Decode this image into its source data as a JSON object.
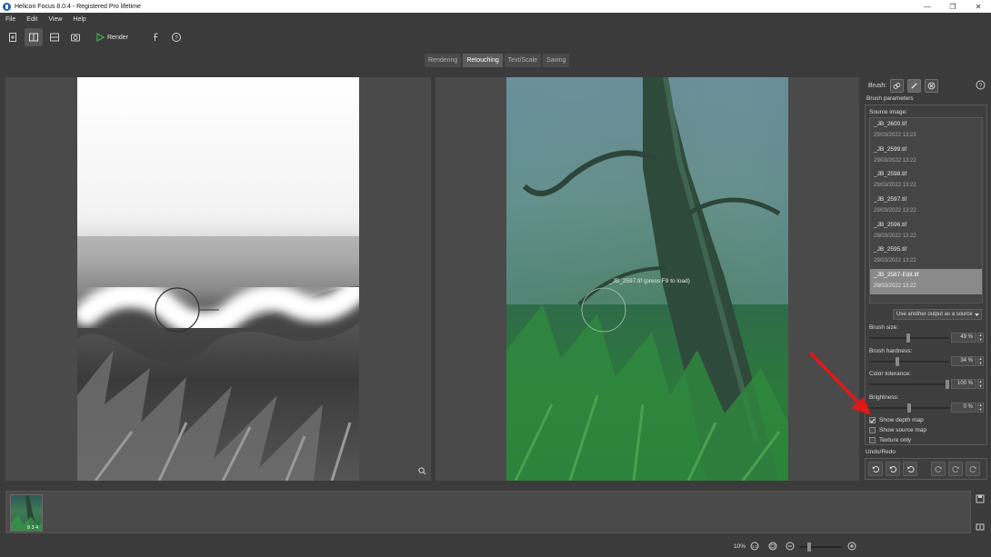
{
  "window": {
    "title": "Helicon Focus 8.0.4 - Registered Pro lifetime",
    "controls": [
      "—",
      "❐",
      "✕"
    ]
  },
  "menu": [
    "File",
    "Edit",
    "View",
    "Help"
  ],
  "toolbar": {
    "render_label": "Render"
  },
  "tabs": [
    "Rendering",
    "Retouching",
    "Text/Scale",
    "Saving"
  ],
  "active_tab": "Retouching",
  "viewer": {
    "overlay_text": "_JB_2597.tif (press F9 to load)"
  },
  "panel": {
    "brush_label": "Brush:",
    "params_header": "Brush parameters",
    "source_label": "Source image:",
    "sources": [
      {
        "name": "_JB_2600.tif",
        "date": "29/03/2022 13:23"
      },
      {
        "name": "_JB_2599.tif",
        "date": "29/03/2022 13:22"
      },
      {
        "name": "_JB_2598.tif",
        "date": "29/03/2022 13:22"
      },
      {
        "name": "_JB_2597.tif",
        "date": "29/03/2022 13:22"
      },
      {
        "name": "_JB_2596.tif",
        "date": "29/03/2022 13:22"
      },
      {
        "name": "_JB_2595.tif",
        "date": "29/03/2022 13:22"
      },
      {
        "name": "_JB_2587-Edit.tif",
        "date": "29/03/2022 13:22"
      }
    ],
    "selected_source": 6,
    "use_output": "Use another output as a source",
    "brush_size": {
      "label": "Brush size:",
      "value": "49 %",
      "level": 0.49
    },
    "brush_hardness": {
      "label": "Brush hardness:",
      "value": "34 %",
      "level": 0.34
    },
    "color_tolerance": {
      "label": "Color tolerance:",
      "value": "100 %",
      "level": 1.0
    },
    "brightness": {
      "label": "Brightness:",
      "value": "0 %",
      "level": 0.5
    },
    "show_depth_map": {
      "label": "Show depth map",
      "checked": true
    },
    "show_source_map": {
      "label": "Show source map",
      "checked": false
    },
    "texture_only": {
      "label": "Texture only",
      "checked": false
    },
    "undo_label": "Undo/Redo"
  },
  "strip": {
    "thumb_count": "8 3 4"
  },
  "status": {
    "zoom": "10%"
  },
  "colors": {
    "background": "#3b3b3b",
    "pane": "#4a4a4a",
    "annotation_arrow": "#e01818",
    "render_green": "#39b54a"
  }
}
